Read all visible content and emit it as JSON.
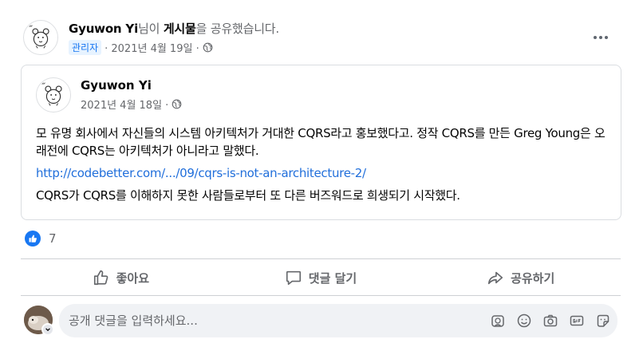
{
  "post": {
    "author": "Gyuwon Yi",
    "suffix": "님이",
    "object": "게시물",
    "action": "을 공유했습니다.",
    "role": "관리자",
    "date": "· 2021년 4월 19일 ·",
    "more_icon": "more-horizontal-icon"
  },
  "shared": {
    "author": "Gyuwon Yi",
    "date": "2021년 4월 18일 ·",
    "paragraphs": [
      "모 유명 회사에서 자신들의 시스템 아키텍처가 거대한 CQRS라고 홍보했다고. 정작 CQRS를 만든 Greg Young은 오래전에 CQRS는 아키텍처가 아니라고 말했다.",
      "CQRS가 CQRS를 이해하지 못한 사람들로부터 또 다른 버즈워드로 희생되기 시작했다."
    ],
    "link": "http://codebetter.com/.../09/cqrs-is-not-an-architecture-2/"
  },
  "reactions": {
    "count": "7",
    "icon": "like-reaction-icon",
    "color": "#1877f2"
  },
  "actions": {
    "like": "좋아요",
    "comment": "댓글 달기",
    "share": "공유하기"
  },
  "comment": {
    "placeholder": "공개 댓글을 입력하세요...",
    "tools": [
      "sticker-avatar-icon",
      "emoji-icon",
      "camera-icon",
      "gif-icon",
      "sticker-icon"
    ]
  }
}
